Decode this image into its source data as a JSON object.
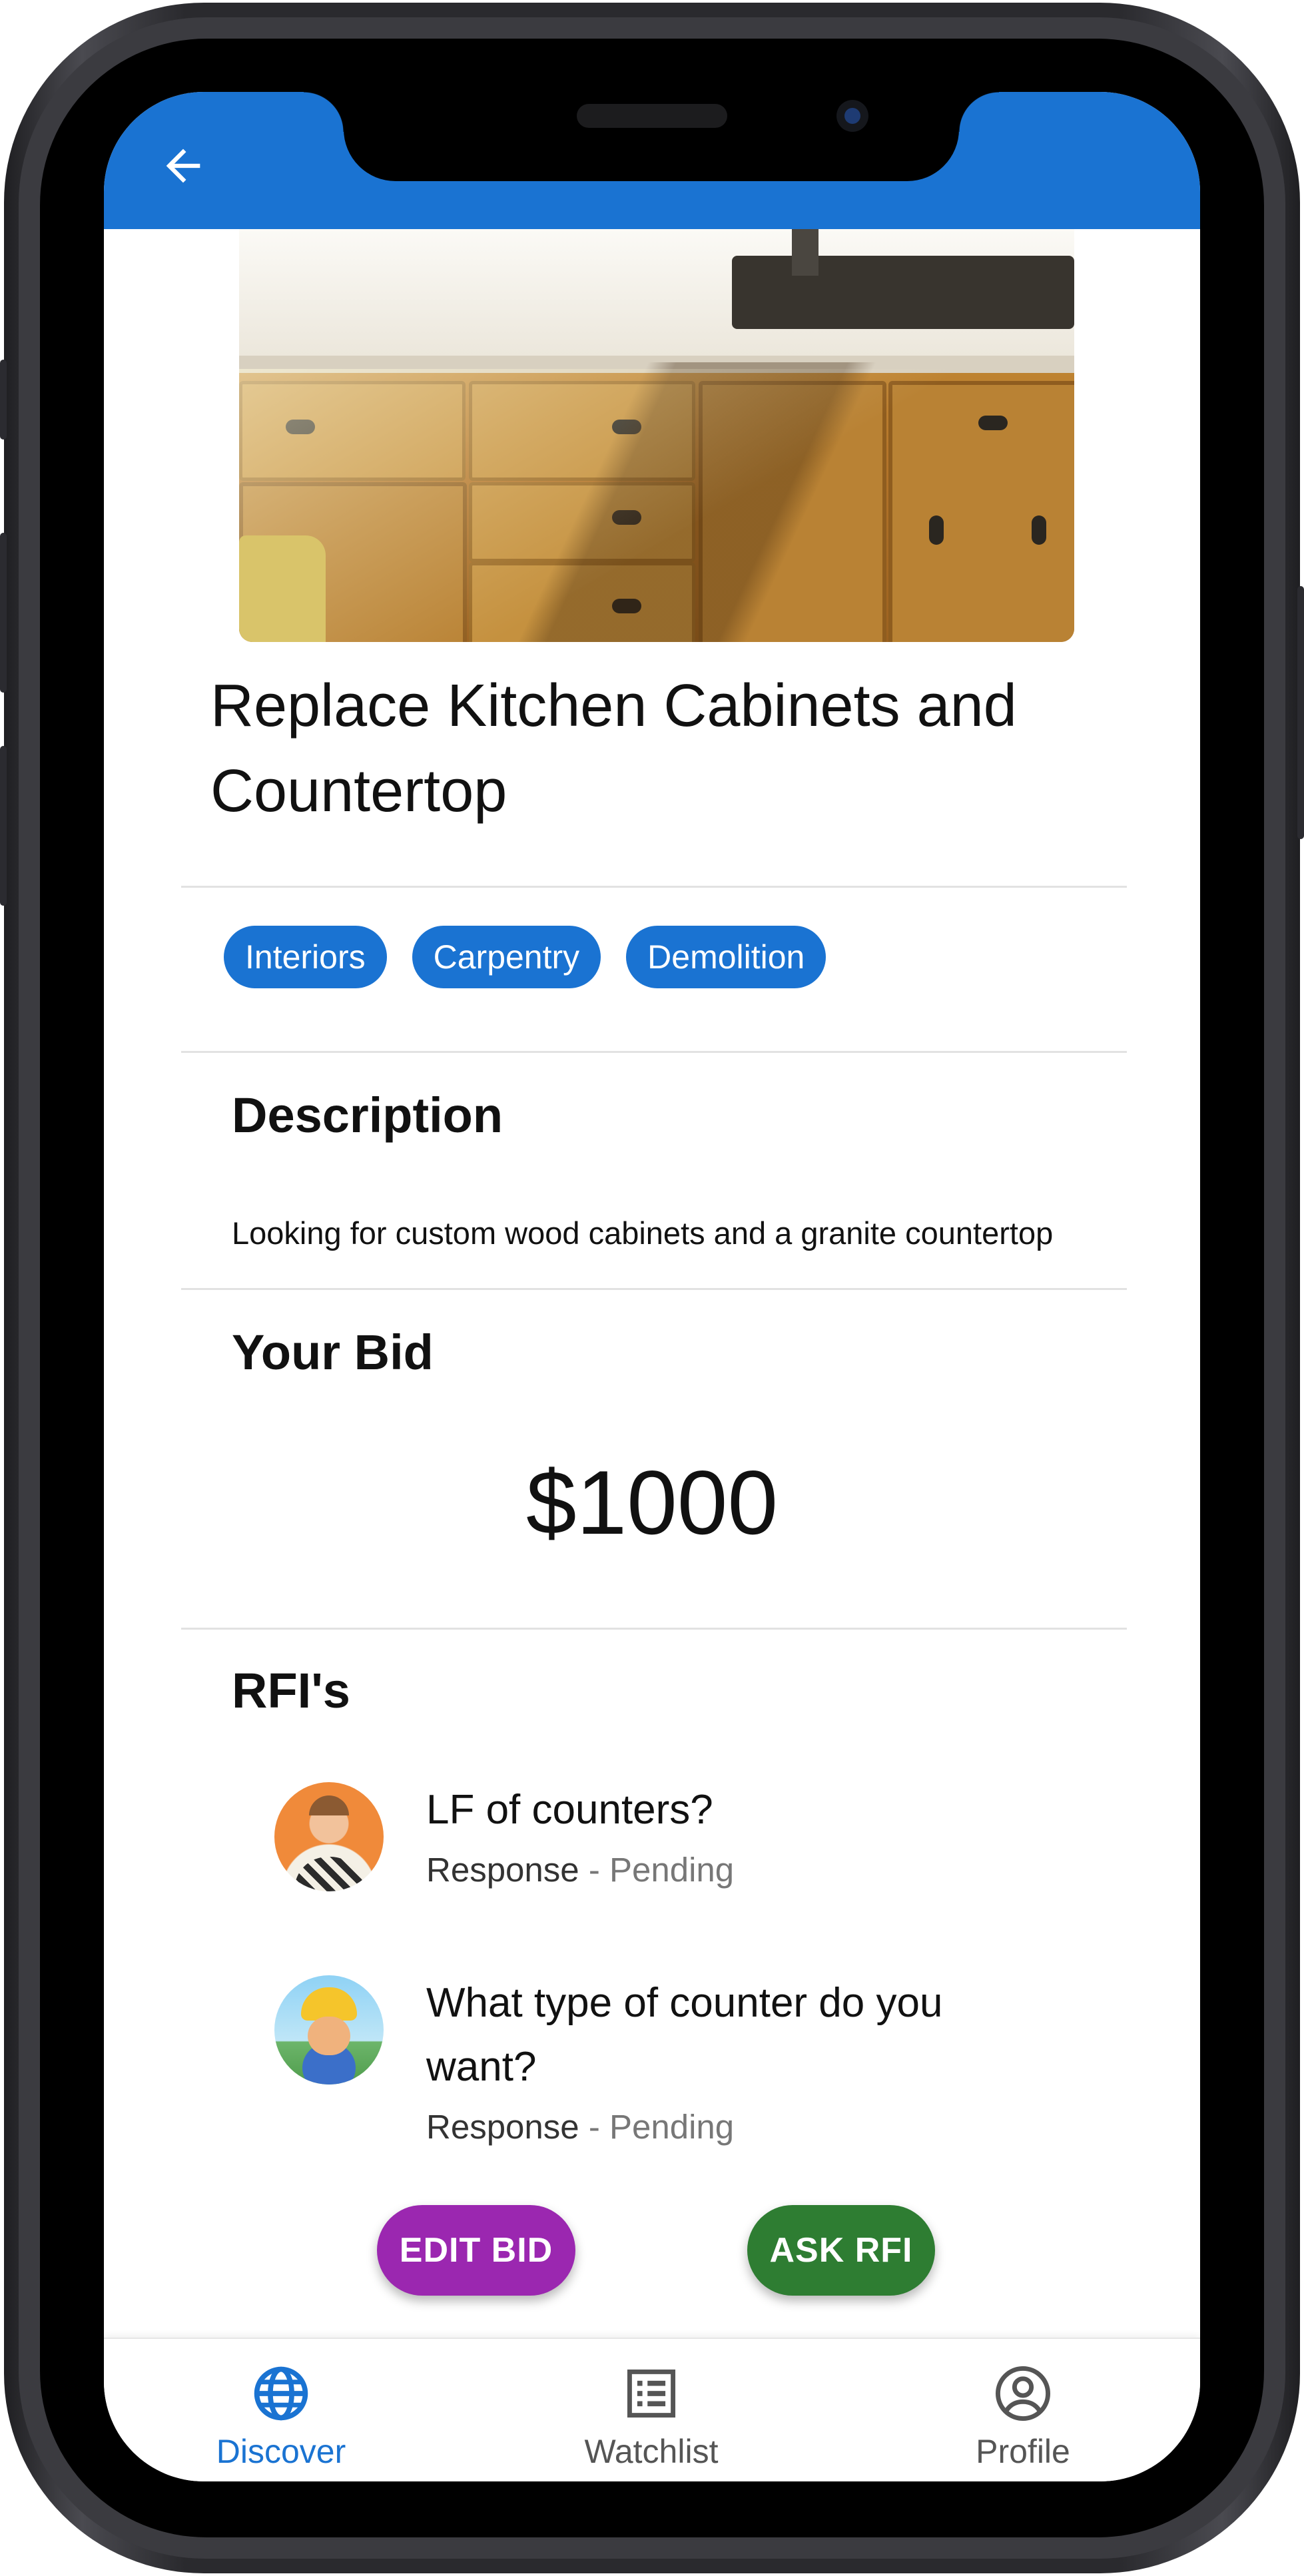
{
  "app_bar": {
    "back_icon": "arrow-left-icon",
    "color": "#1a73d2"
  },
  "project": {
    "title": "Replace Kitchen Cabinets and Countertop",
    "tags": [
      "Interiors",
      "Carpentry",
      "Demolition"
    ]
  },
  "description": {
    "heading": "Description",
    "text": "Looking for custom wood cabinets and a granite countertop"
  },
  "bid": {
    "heading": "Your Bid",
    "amount": "$1000"
  },
  "rfis": {
    "heading": "RFI's",
    "items": [
      {
        "question": "LF of counters?",
        "response_label": "Response",
        "separator": " - ",
        "status": "Pending"
      },
      {
        "question": "What type of counter do you want?",
        "response_label": "Response",
        "separator": " - ",
        "status": "Pending"
      }
    ]
  },
  "actions": {
    "edit_bid": {
      "label": "EDIT BID",
      "color": "#9b27b0"
    },
    "ask_rfi": {
      "label": "ASK RFI",
      "color": "#2e7d32"
    }
  },
  "bottom_nav": {
    "items": [
      {
        "label": "Discover",
        "icon": "globe-icon",
        "active": true
      },
      {
        "label": "Watchlist",
        "icon": "list-icon",
        "active": false
      },
      {
        "label": "Profile",
        "icon": "account-circle-icon",
        "active": false
      }
    ]
  }
}
